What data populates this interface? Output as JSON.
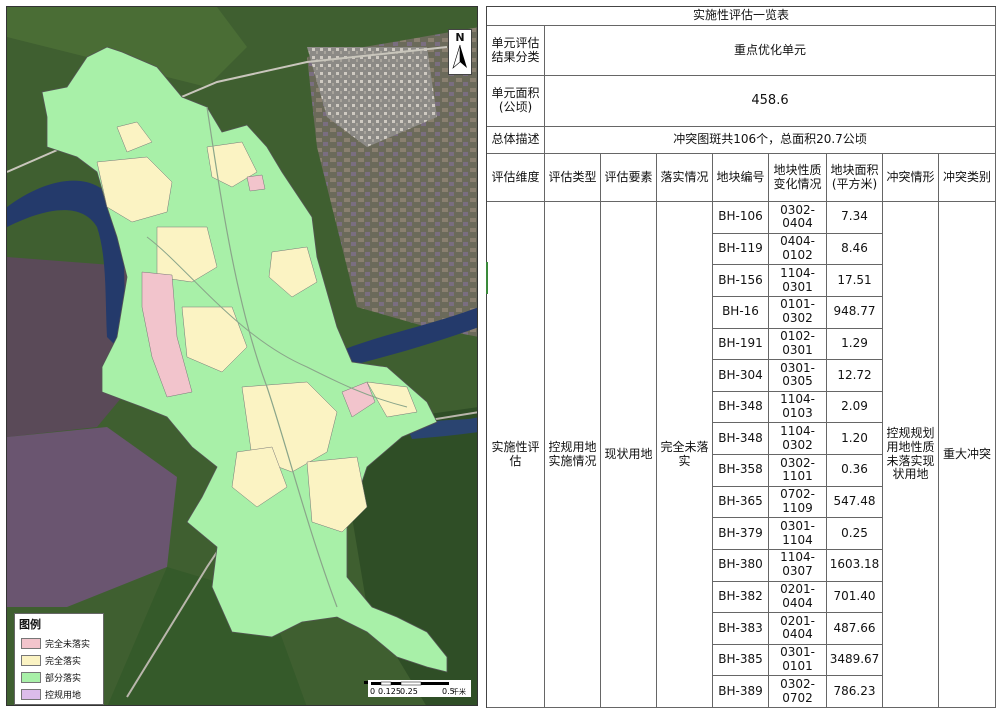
{
  "colors": {
    "fully_unimplemented": "#f2c4cc",
    "fully_implemented": "#fbf3c3",
    "partially_implemented": "#a8f0a8",
    "regulatory_land": "#dcbcea",
    "river": "#243a6b",
    "forest": "#345a2a"
  },
  "map": {
    "north_label": "N",
    "legend": {
      "title": "图例",
      "items": [
        {
          "label": "完全未落实",
          "color": "#f2c4cc"
        },
        {
          "label": "完全落实",
          "color": "#fbf3c3"
        },
        {
          "label": "部分落实",
          "color": "#a8f0a8"
        },
        {
          "label": "控规用地",
          "color": "#dcbcea"
        }
      ]
    },
    "scale": {
      "t0": "0",
      "t1": "0.125",
      "t2": "0.25",
      "t3": "0.5",
      "unit": "千米"
    }
  },
  "table": {
    "title": "实施性评估一览表",
    "result_label": "单元评估结果分类",
    "result_value": "重点优化单元",
    "area_label": "单元面积(公顷)",
    "area_value": "458.6",
    "summary_label": "总体描述",
    "summary_value": "冲突图斑共106个，总面积20.7公顷",
    "headers": [
      "评估维度",
      "评估类型",
      "评估要素",
      "落实情况",
      "地块编号",
      "地块性质变化情况",
      "地块面积(平方米)",
      "冲突情形",
      "冲突类别"
    ],
    "dimension": "实施性评估",
    "type": "控规用地实施情况",
    "element": "现状用地",
    "status": "完全未落实",
    "conflict_situation": "控规规划用地性质未落实现状用地",
    "conflict_category": "重大冲突",
    "rows": [
      {
        "id": "BH-106",
        "change": "0302-0404",
        "area": "7.34"
      },
      {
        "id": "BH-119",
        "change": "0404-0102",
        "area": "8.46"
      },
      {
        "id": "BH-156",
        "change": "1104-0301",
        "area": "17.51"
      },
      {
        "id": "BH-16",
        "change": "0101-0302",
        "area": "948.77"
      },
      {
        "id": "BH-191",
        "change": "0102-0301",
        "area": "1.29"
      },
      {
        "id": "BH-304",
        "change": "0301-0305",
        "area": "12.72"
      },
      {
        "id": "BH-348",
        "change": "1104-0103",
        "area": "2.09"
      },
      {
        "id": "BH-348",
        "change": "1104-0302",
        "area": "1.20"
      },
      {
        "id": "BH-358",
        "change": "0302-1101",
        "area": "0.36"
      },
      {
        "id": "BH-365",
        "change": "0702-1109",
        "area": "547.48"
      },
      {
        "id": "BH-379",
        "change": "0301-1104",
        "area": "0.25"
      },
      {
        "id": "BH-380",
        "change": "1104-0307",
        "area": "1603.18"
      },
      {
        "id": "BH-382",
        "change": "0201-0404",
        "area": "701.40"
      },
      {
        "id": "BH-383",
        "change": "0201-0404",
        "area": "487.66"
      },
      {
        "id": "BH-385",
        "change": "0301-0101",
        "area": "3489.67"
      },
      {
        "id": "BH-389",
        "change": "0302-0702",
        "area": "786.23"
      }
    ]
  }
}
